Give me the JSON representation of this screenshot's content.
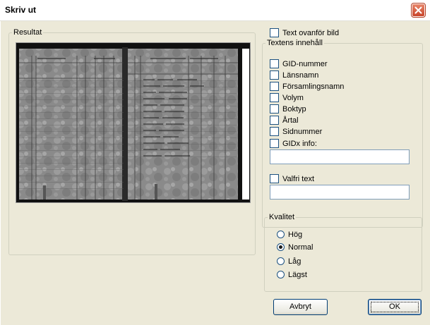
{
  "window": {
    "title": "Skriv ut"
  },
  "preview": {
    "label": "Resultat"
  },
  "text_above": {
    "label": "Text ovanför bild",
    "checked": false
  },
  "content_group": {
    "label": "Textens innehåll",
    "options": [
      {
        "label": "GID-nummer",
        "checked": false
      },
      {
        "label": "Länsnamn",
        "checked": false
      },
      {
        "label": "Församlingsnamn",
        "checked": false
      },
      {
        "label": "Volym",
        "checked": false
      },
      {
        "label": "Boktyp",
        "checked": false
      },
      {
        "label": "Årtal",
        "checked": false
      },
      {
        "label": "Sidnummer",
        "checked": false
      },
      {
        "label": "GIDx info:",
        "checked": false
      }
    ],
    "gidx_value": "",
    "free_text": {
      "label": "Valfri text",
      "checked": false,
      "value": ""
    }
  },
  "quality": {
    "label": "Kvalitet",
    "options": [
      "Hög",
      "Normal",
      "Låg",
      "Lägst"
    ],
    "selected": "Normal"
  },
  "buttons": {
    "cancel": "Avbryt",
    "ok": "OK"
  }
}
